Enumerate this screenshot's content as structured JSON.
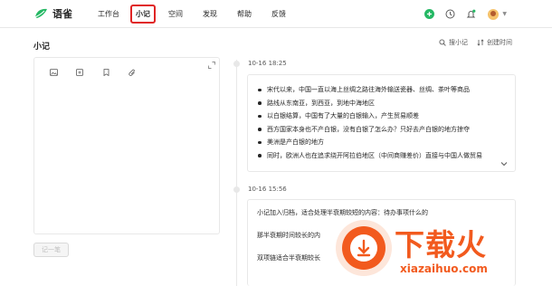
{
  "app": {
    "name": "语雀"
  },
  "nav": {
    "items": [
      {
        "label": "工作台"
      },
      {
        "label": "小记"
      },
      {
        "label": "空间"
      },
      {
        "label": "发现"
      },
      {
        "label": "帮助"
      },
      {
        "label": "反馈"
      }
    ],
    "active": "小记"
  },
  "top_icons": [
    "add-icon",
    "clock-icon",
    "bell-icon",
    "avatar"
  ],
  "page": {
    "title": "小记",
    "search_label": "搜小记",
    "sort_label": "创建时间"
  },
  "editor": {
    "tools": [
      "image-icon",
      "attachment-card-icon",
      "bookmark-icon",
      "paperclip-icon"
    ],
    "submit_label": "记一笔"
  },
  "notes": [
    {
      "time": "10-16 18:25",
      "bullets": [
        "宋代以来，中国一直以海上丝绸之路往海外输送瓷器、丝绸、茶叶等商品",
        "路线从东南亚，到西亚，到地中海地区",
        "以白银结算，中国有了大量的白银输入，产生贸易顺差",
        "西方国家本身也不产白银，没有白银了怎么办？只好去产白银的地方掠夺",
        "美洲是产白银的地方",
        "同时，欧洲人也在追求绕开阿拉伯地区（中间商赚差价）直接与中国人做贸易"
      ]
    },
    {
      "time": "10-16 15:56",
      "lines": [
        "小记加入归档，适合处理半衰期较短的内容：待办事项什么的",
        "那半衰期时间较长的内",
        "双项链适合半衰期较长"
      ]
    }
  ],
  "watermark": {
    "text": "下载火",
    "url": "xiazaihuo.com"
  },
  "colors": {
    "brand_green": "#25b864",
    "highlight_red": "#e02424",
    "watermark_orange": "#f25a1e"
  }
}
